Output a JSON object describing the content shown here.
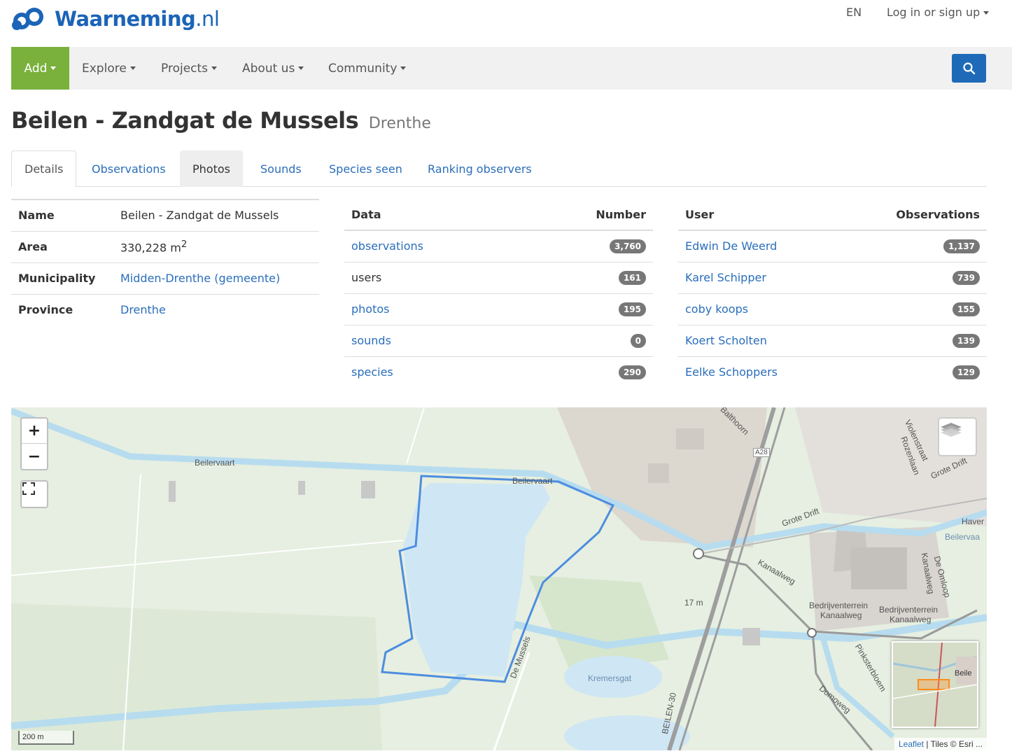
{
  "header": {
    "logo_brand": "Waarneming",
    "logo_tld": ".nl",
    "language": "EN",
    "login_label": "Log in or sign up"
  },
  "nav": {
    "add": "Add",
    "explore": "Explore",
    "projects": "Projects",
    "about": "About us",
    "community": "Community",
    "search_icon": "search-icon"
  },
  "page": {
    "title": "Beilen - Zandgat de Mussels",
    "subtitle": "Drenthe"
  },
  "tabs": [
    {
      "label": "Details",
      "state": "active"
    },
    {
      "label": "Observations",
      "state": "link"
    },
    {
      "label": "Photos",
      "state": "hover"
    },
    {
      "label": "Sounds",
      "state": "link"
    },
    {
      "label": "Species seen",
      "state": "link"
    },
    {
      "label": "Ranking observers",
      "state": "link"
    }
  ],
  "details": {
    "name_key": "Name",
    "name_val": "Beilen - Zandgat de Mussels",
    "area_key": "Area",
    "area_val": "330,228 m",
    "area_sup": "2",
    "municipality_key": "Municipality",
    "municipality_val": "Midden-Drenthe (gemeente)",
    "province_key": "Province",
    "province_val": "Drenthe"
  },
  "data_table": {
    "col_data": "Data",
    "col_number": "Number",
    "rows": [
      {
        "label": "observations",
        "count": "3,760",
        "link": true
      },
      {
        "label": "users",
        "count": "161",
        "link": false
      },
      {
        "label": "photos",
        "count": "195",
        "link": true
      },
      {
        "label": "sounds",
        "count": "0",
        "link": true
      },
      {
        "label": "species",
        "count": "290",
        "link": true
      }
    ]
  },
  "user_table": {
    "col_user": "User",
    "col_obs": "Observations",
    "rows": [
      {
        "name": "Edwin De Weerd",
        "count": "1,137"
      },
      {
        "name": "Karel Schipper",
        "count": "739"
      },
      {
        "name": "coby koops",
        "count": "155"
      },
      {
        "name": "Koert Scholten",
        "count": "139"
      },
      {
        "name": "Eelke Schoppers",
        "count": "129"
      }
    ]
  },
  "map": {
    "zoom_in": "+",
    "zoom_out": "−",
    "scale": "200 m",
    "attribution_link": "Leaflet",
    "attribution_rest": " | Tiles © Esri ...",
    "minimap_label": "Beile",
    "labels": [
      "Beilervaart",
      "Beilervaart",
      "Grote Drift",
      "Kanaalweg",
      "Kremersgat",
      "BEILEN-30",
      "Bedrijventerrein",
      "Kanaalweg",
      "Bedrijventerrein",
      "Kanaalweg",
      "Domoweg",
      "Pinksterbloem",
      "De Omloop",
      "Kanaalweg",
      "Violenstraat",
      "Rozenlaan",
      "Grote Drift",
      "Haver",
      "Beilervaa",
      "Balthoorn",
      "A28",
      "17 m",
      "De Mussels"
    ],
    "water_color": "#cfe6f4",
    "outline_color": "#4d8de0"
  }
}
